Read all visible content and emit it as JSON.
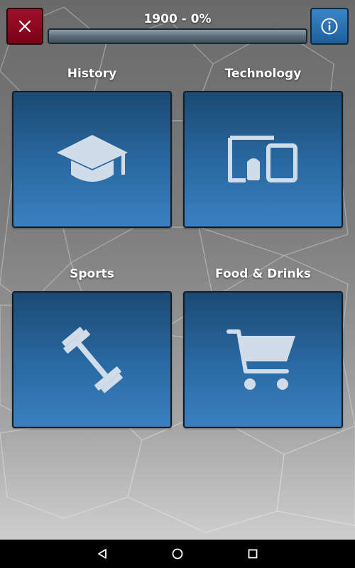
{
  "header": {
    "progress_label": "1900 - 0%",
    "progress_percent": 0,
    "close_icon": "close-icon",
    "info_icon": "info-icon"
  },
  "categories": [
    {
      "label": "History",
      "icon": "graduation-cap-icon"
    },
    {
      "label": "Technology",
      "icon": "devices-icon"
    },
    {
      "label": "Sports",
      "icon": "dumbbell-icon"
    },
    {
      "label": "Food & Drinks",
      "icon": "shopping-cart-icon"
    }
  ],
  "nav_bar": {
    "back_icon": "back-triangle-icon",
    "home_icon": "home-circle-icon",
    "recents_icon": "recents-square-icon"
  },
  "colors": {
    "close_button": "#8b0a20",
    "info_button": "#2b72b3",
    "tile_top": "#1b4a72",
    "tile_bottom": "#3a80c0",
    "icon_fill": "#d0dde8"
  }
}
